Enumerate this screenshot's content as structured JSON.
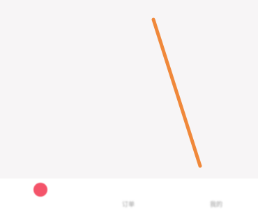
{
  "colors": {
    "background": "#f7f5f6",
    "bottom_bar": "#ffffff",
    "pointer": "#f0883a",
    "record_indicator": "#f4546a"
  },
  "icons": {
    "record_indicator": "record-dot-icon",
    "pointer": "needle-line-icon"
  },
  "bottom_tabs": [
    {
      "label": ""
    },
    {
      "label": "订单"
    },
    {
      "label": "我的"
    }
  ]
}
